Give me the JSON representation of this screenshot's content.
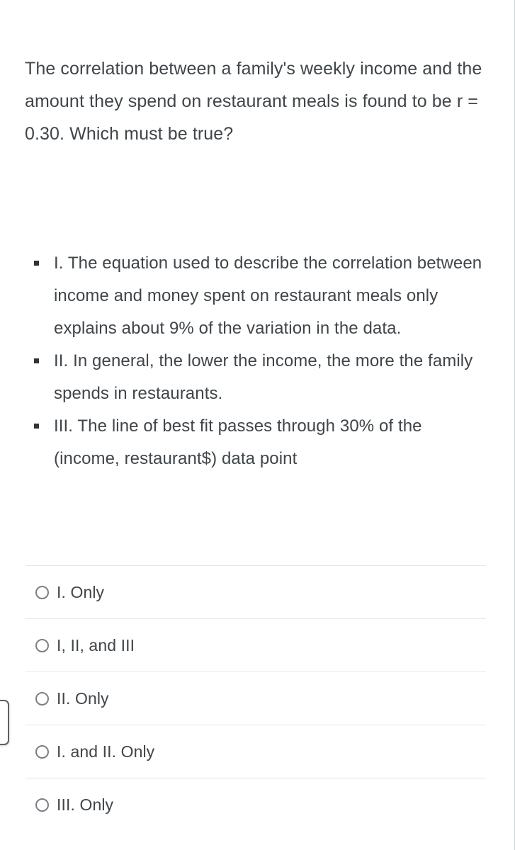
{
  "question": {
    "text": "The correlation between a family's weekly income and the amount they spend on restaurant meals is found to be r = 0.30. Which must be true?",
    "correlation_value": "r = 0.30"
  },
  "statements": [
    {
      "marker": "square-bullet",
      "text": "I.  The equation used to describe the correlation between income and money spent on restaurant meals only explains about 9% of the variation in the data."
    },
    {
      "marker": "square-bullet",
      "text": "II.  In general, the lower the income, the more the family spends in restaurants."
    },
    {
      "marker": "square-bullet",
      "text": "III. The line of best fit passes through 30% of the (income, restaurant$) data point"
    }
  ],
  "options": [
    {
      "label": "I. Only",
      "selected": false
    },
    {
      "label": "I, II, and III",
      "selected": false
    },
    {
      "label": "II. Only",
      "selected": false
    },
    {
      "label": "I. and II. Only",
      "selected": false
    },
    {
      "label": "III. Only",
      "selected": false
    }
  ],
  "colors": {
    "text": "#3f4549",
    "divider": "#e6e7e8",
    "radio_border": "#7b7f83",
    "bullet": "#2d3338",
    "page_border": "#cfd2d4",
    "background": "#ffffff"
  }
}
